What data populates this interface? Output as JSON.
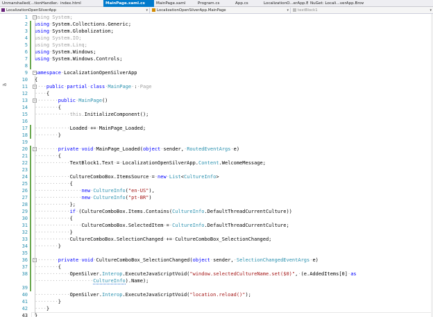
{
  "tabs": [
    {
      "label": "Unmarshalled(...tionHandler.cs",
      "active": false
    },
    {
      "label": "index.html",
      "active": false
    },
    {
      "label": "MainPage.xaml.cs",
      "active": true
    },
    {
      "label": "MainPage.xaml",
      "active": false
    },
    {
      "label": "Program.cs",
      "active": false
    },
    {
      "label": "App.cs",
      "active": false
    },
    {
      "label": "LocalizationO...erApp.Browser",
      "active": false
    },
    {
      "label": "NuGet: Locali...verApp.Browser",
      "active": false
    }
  ],
  "navbar": {
    "project": "LocalizationOpenSilverApp",
    "type": "LocalizationOpenSilverApp.MainPage",
    "member": "textBlock1"
  },
  "editor": {
    "reference_hint": "r0",
    "lines": [
      {
        "n": "1",
        "tokens": [
          [
            "fa",
            "using System;"
          ]
        ]
      },
      {
        "n": "2",
        "tokens": [
          [
            "kw",
            "using"
          ],
          [
            "ws",
            "·"
          ],
          [
            "pl",
            "System.Collections.Generic;"
          ]
        ]
      },
      {
        "n": "3",
        "tokens": [
          [
            "kw",
            "using"
          ],
          [
            "ws",
            "·"
          ],
          [
            "pl",
            "System.Globalization;"
          ]
        ]
      },
      {
        "n": "4",
        "tokens": [
          [
            "fa",
            "using System.IO;"
          ]
        ]
      },
      {
        "n": "5",
        "tokens": [
          [
            "fa",
            "using System.Linq;"
          ]
        ]
      },
      {
        "n": "6",
        "tokens": [
          [
            "kw",
            "using"
          ],
          [
            "ws",
            "·"
          ],
          [
            "pl",
            "System.Windows;"
          ]
        ]
      },
      {
        "n": "7",
        "tokens": [
          [
            "kw",
            "using"
          ],
          [
            "ws",
            "·"
          ],
          [
            "pl",
            "System.Windows.Controls;"
          ]
        ]
      },
      {
        "n": "8",
        "tokens": []
      },
      {
        "n": "9",
        "tokens": [
          [
            "kw",
            "namespace"
          ],
          [
            "ws",
            "·"
          ],
          [
            "pl",
            "LocalizationOpenSilverApp"
          ]
        ]
      },
      {
        "n": "10",
        "tokens": [
          [
            "pl",
            "{"
          ]
        ]
      },
      {
        "n": "11",
        "tokens": [
          [
            "ws",
            "····"
          ],
          [
            "kw",
            "public"
          ],
          [
            "ws",
            "·"
          ],
          [
            "kw",
            "partial"
          ],
          [
            "ws",
            "·"
          ],
          [
            "kw",
            "class"
          ],
          [
            "ws",
            "·"
          ],
          [
            "ty",
            "MainPage"
          ],
          [
            "ws",
            "·"
          ],
          [
            "pl",
            ":"
          ],
          [
            "ws",
            "·"
          ],
          [
            "fa",
            "Page"
          ]
        ]
      },
      {
        "n": "12",
        "tokens": [
          [
            "ws",
            "····"
          ],
          [
            "pl",
            "{"
          ]
        ]
      },
      {
        "n": "13",
        "tokens": [
          [
            "ws",
            "········"
          ],
          [
            "kw",
            "public"
          ],
          [
            "ws",
            "·"
          ],
          [
            "ty",
            "MainPage"
          ],
          [
            "pl",
            "()"
          ]
        ]
      },
      {
        "n": "14",
        "tokens": [
          [
            "ws",
            "········"
          ],
          [
            "pl",
            "{"
          ]
        ]
      },
      {
        "n": "15",
        "tokens": [
          [
            "ws",
            "············"
          ],
          [
            "fa",
            "this."
          ],
          [
            "pl",
            "InitializeComponent();"
          ]
        ]
      },
      {
        "n": "16",
        "tokens": []
      },
      {
        "n": "17",
        "tokens": [
          [
            "ws",
            "············"
          ],
          [
            "pl",
            "Loaded"
          ],
          [
            "ws",
            "·"
          ],
          [
            "pl",
            "+="
          ],
          [
            "ws",
            "·"
          ],
          [
            "pl",
            "MainPage_Loaded;"
          ]
        ]
      },
      {
        "n": "18",
        "tokens": [
          [
            "ws",
            "········"
          ],
          [
            "pl",
            "}"
          ]
        ]
      },
      {
        "n": "19",
        "tokens": []
      },
      {
        "n": "20",
        "tokens": [
          [
            "ws",
            "········"
          ],
          [
            "kw",
            "private"
          ],
          [
            "ws",
            "·"
          ],
          [
            "kw",
            "void"
          ],
          [
            "ws",
            "·"
          ],
          [
            "pl",
            "MainPage_Loaded("
          ],
          [
            "kw",
            "object"
          ],
          [
            "ws",
            "·"
          ],
          [
            "pl",
            "sender,"
          ],
          [
            "ws",
            "·"
          ],
          [
            "ty",
            "RoutedEventArgs"
          ],
          [
            "ws",
            "·"
          ],
          [
            "pl",
            "e)"
          ]
        ]
      },
      {
        "n": "21",
        "tokens": [
          [
            "ws",
            "········"
          ],
          [
            "pl",
            "{"
          ]
        ]
      },
      {
        "n": "22",
        "tokens": [
          [
            "ws",
            "············"
          ],
          [
            "pl",
            "TextBlock1.Text"
          ],
          [
            "ws",
            "·"
          ],
          [
            "pl",
            "="
          ],
          [
            "ws",
            "·"
          ],
          [
            "pl",
            "LocalizationOpenSilverApp."
          ],
          [
            "ty",
            "Content"
          ],
          [
            "pl",
            ".WelcomeMessage;"
          ]
        ]
      },
      {
        "n": "23",
        "tokens": []
      },
      {
        "n": "24",
        "tokens": [
          [
            "ws",
            "············"
          ],
          [
            "pl",
            "CultureComboBox.ItemsSource"
          ],
          [
            "ws",
            "·"
          ],
          [
            "pl",
            "="
          ],
          [
            "ws",
            "·"
          ],
          [
            "kw",
            "new"
          ],
          [
            "ws",
            "·"
          ],
          [
            "ty",
            "List"
          ],
          [
            "pl",
            "<"
          ],
          [
            "ty",
            "CultureInfo"
          ],
          [
            "pl",
            ">"
          ]
        ]
      },
      {
        "n": "25",
        "tokens": [
          [
            "ws",
            "············"
          ],
          [
            "pl",
            "{"
          ]
        ]
      },
      {
        "n": "26",
        "tokens": [
          [
            "ws",
            "················"
          ],
          [
            "kw",
            "new"
          ],
          [
            "ws",
            "·"
          ],
          [
            "ty",
            "CultureInfo"
          ],
          [
            "pl",
            "("
          ],
          [
            "str",
            "\"en-US\""
          ],
          [
            "pl",
            "),"
          ]
        ]
      },
      {
        "n": "27",
        "tokens": [
          [
            "ws",
            "················"
          ],
          [
            "kw",
            "new"
          ],
          [
            "ws",
            "·"
          ],
          [
            "ty",
            "CultureInfo"
          ],
          [
            "pl",
            "("
          ],
          [
            "str",
            "\"pt-BR\""
          ],
          [
            "pl",
            ")"
          ]
        ]
      },
      {
        "n": "28",
        "tokens": [
          [
            "ws",
            "············"
          ],
          [
            "pl",
            "};"
          ]
        ]
      },
      {
        "n": "29",
        "tokens": [
          [
            "ws",
            "············"
          ],
          [
            "kw",
            "if"
          ],
          [
            "ws",
            "·"
          ],
          [
            "pl",
            "(CultureComboBox.Items.Contains("
          ],
          [
            "ty",
            "CultureInfo"
          ],
          [
            "pl",
            ".DefaultThreadCurrentCulture))"
          ]
        ]
      },
      {
        "n": "30",
        "tokens": [
          [
            "ws",
            "············"
          ],
          [
            "pl",
            "{"
          ]
        ]
      },
      {
        "n": "31",
        "tokens": [
          [
            "ws",
            "················"
          ],
          [
            "pl",
            "CultureComboBox.SelectedItem"
          ],
          [
            "ws",
            "·"
          ],
          [
            "pl",
            "="
          ],
          [
            "ws",
            "·"
          ],
          [
            "ty",
            "CultureInfo"
          ],
          [
            "pl",
            ".DefaultThreadCurrentCulture;"
          ]
        ]
      },
      {
        "n": "32",
        "tokens": [
          [
            "ws",
            "············"
          ],
          [
            "pl",
            "}"
          ]
        ]
      },
      {
        "n": "33",
        "tokens": [
          [
            "ws",
            "············"
          ],
          [
            "pl",
            "CultureComboBox.SelectionChanged"
          ],
          [
            "ws",
            "·"
          ],
          [
            "pl",
            "+="
          ],
          [
            "ws",
            "·"
          ],
          [
            "pl",
            "CultureComboBox_SelectionChanged;"
          ]
        ]
      },
      {
        "n": "34",
        "tokens": [
          [
            "ws",
            "········"
          ],
          [
            "pl",
            "}"
          ]
        ]
      },
      {
        "n": "35",
        "tokens": []
      },
      {
        "n": "36",
        "tokens": [
          [
            "ws",
            "········"
          ],
          [
            "kw",
            "private"
          ],
          [
            "ws",
            "·"
          ],
          [
            "kw",
            "void"
          ],
          [
            "ws",
            "·"
          ],
          [
            "pl",
            "CultureComboBox_SelectionChanged("
          ],
          [
            "kw",
            "object"
          ],
          [
            "ws",
            "·"
          ],
          [
            "pl",
            "sender,"
          ],
          [
            "ws",
            "·"
          ],
          [
            "ty",
            "SelectionChangedEventArgs"
          ],
          [
            "ws",
            "·"
          ],
          [
            "pl",
            "e)"
          ]
        ]
      },
      {
        "n": "37",
        "tokens": [
          [
            "ws",
            "········"
          ],
          [
            "pl",
            "{"
          ]
        ]
      },
      {
        "n": "38",
        "tokens": [
          [
            "ws",
            "············"
          ],
          [
            "pl",
            "OpenSilver."
          ],
          [
            "ty",
            "Interop"
          ],
          [
            "pl",
            ".ExecuteJavaScriptVoid("
          ],
          [
            "str",
            "\"window.selectedCultureName.set($0)\""
          ],
          [
            "pl",
            ","
          ],
          [
            "ws",
            "·"
          ],
          [
            "pl",
            "(e.AddedItems[0]"
          ],
          [
            "ws",
            "·"
          ],
          [
            "kw",
            "as"
          ]
        ]
      },
      {
        "n": "38b",
        "tokens": [
          [
            "ws",
            "····················"
          ],
          [
            "ty",
            "CultureInfo"
          ],
          [
            "pl",
            ").Name);"
          ]
        ]
      },
      {
        "n": "39",
        "tokens": []
      },
      {
        "n": "40",
        "tokens": [
          [
            "ws",
            "············"
          ],
          [
            "pl",
            "OpenSilver."
          ],
          [
            "ty",
            "Interop"
          ],
          [
            "pl",
            ".ExecuteJavaScriptVoid("
          ],
          [
            "str",
            "\"location.reload()\""
          ],
          [
            "pl",
            ");"
          ]
        ]
      },
      {
        "n": "41",
        "tokens": [
          [
            "ws",
            "········"
          ],
          [
            "pl",
            "}"
          ]
        ]
      },
      {
        "n": "42",
        "tokens": [
          [
            "ws",
            "····"
          ],
          [
            "pl",
            "}"
          ]
        ]
      },
      {
        "n": "43",
        "tokens": [
          [
            "pl",
            "}"
          ]
        ]
      }
    ]
  }
}
